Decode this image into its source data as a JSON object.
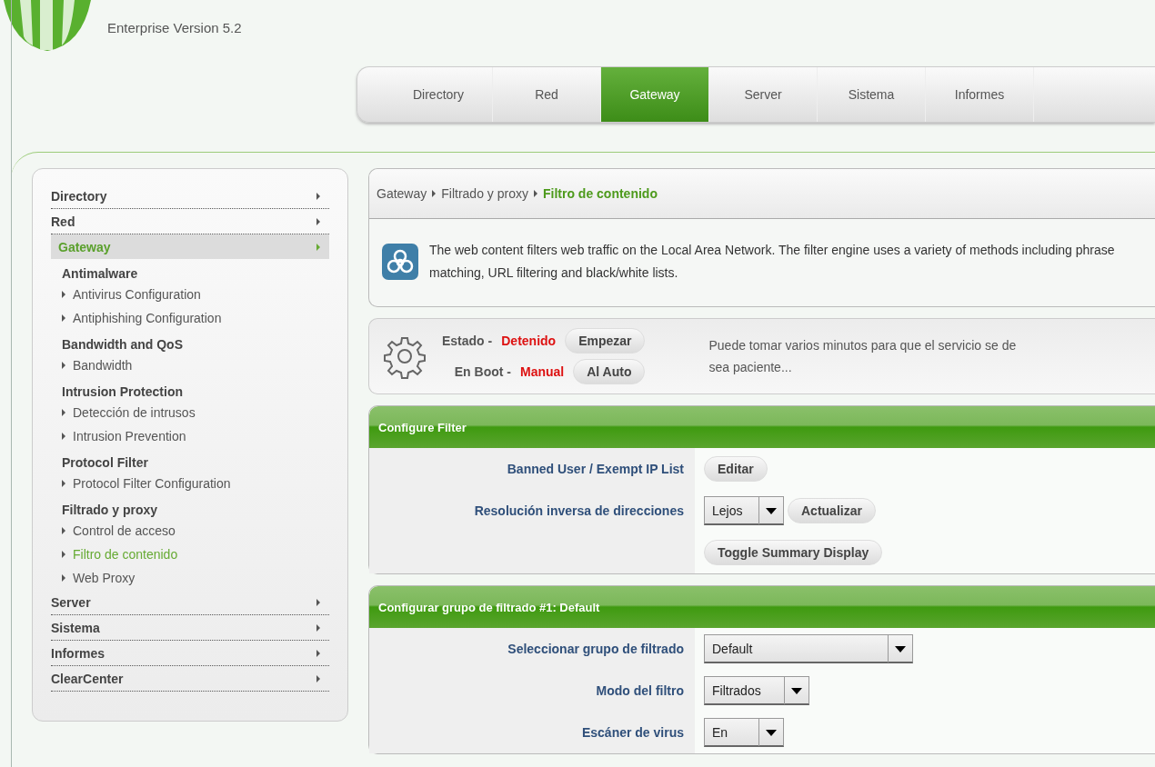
{
  "header": {
    "version": "Enterprise Version 5.2"
  },
  "top_tabs": [
    {
      "label": "Directory",
      "selected": false
    },
    {
      "label": "Red",
      "selected": false
    },
    {
      "label": "Gateway",
      "selected": true
    },
    {
      "label": "Server",
      "selected": false
    },
    {
      "label": "Sistema",
      "selected": false
    },
    {
      "label": "Informes",
      "selected": false
    }
  ],
  "sidebar": {
    "items": [
      {
        "label": "Directory",
        "selected": false
      },
      {
        "label": "Red",
        "selected": false
      },
      {
        "label": "Gateway",
        "selected": true,
        "children": [
          {
            "label": "Antimalware",
            "children": [
              {
                "label": "Antivirus Configuration",
                "selected": false
              },
              {
                "label": "Antiphishing Configuration",
                "selected": false
              }
            ]
          },
          {
            "label": "Bandwidth and QoS",
            "children": [
              {
                "label": "Bandwidth",
                "selected": false
              }
            ]
          },
          {
            "label": "Intrusion Protection",
            "children": [
              {
                "label": "Detección de intrusos",
                "selected": false
              },
              {
                "label": "Intrusion Prevention",
                "selected": false
              }
            ]
          },
          {
            "label": "Protocol Filter",
            "children": [
              {
                "label": "Protocol Filter Configuration",
                "selected": false
              }
            ]
          },
          {
            "label": "Filtrado y proxy",
            "children": [
              {
                "label": "Control de acceso",
                "selected": false
              },
              {
                "label": "Filtro de contenido",
                "selected": true
              },
              {
                "label": "Web Proxy",
                "selected": false
              }
            ]
          }
        ]
      },
      {
        "label": "Server",
        "selected": false
      },
      {
        "label": "Sistema",
        "selected": false
      },
      {
        "label": "Informes",
        "selected": false
      },
      {
        "label": "ClearCenter",
        "selected": false
      }
    ]
  },
  "breadcrumb": [
    {
      "label": "Gateway",
      "current": false
    },
    {
      "label": "Filtrado y proxy",
      "current": false
    },
    {
      "label": "Filtro de contenido",
      "current": true
    }
  ],
  "info": {
    "text": "The web content filters web traffic on the Local Area Network. The filter engine uses a variety of methods including phrase matching, URL filtering and black/white lists."
  },
  "service": {
    "rows": [
      {
        "label": "Estado -",
        "value": "Detenido",
        "button": "Empezar"
      },
      {
        "label": "En Boot -",
        "value": "Manual",
        "button": "Al Auto"
      }
    ],
    "note": [
      "Puede tomar varios minutos para que el servicio se de",
      "sea paciente..."
    ]
  },
  "sections": [
    {
      "title": "Configure Filter",
      "rows": [
        {
          "label": "Banned User / Exempt IP List",
          "controls": [
            {
              "kind": "button",
              "label": "Editar"
            }
          ]
        },
        {
          "label": "Resolución inversa de direcciones",
          "controls": [
            {
              "kind": "select",
              "value": "Lejos"
            },
            {
              "kind": "button",
              "label": "Actualizar"
            }
          ]
        },
        {
          "controls": [
            {
              "kind": "button",
              "label": "Toggle Summary Display"
            }
          ]
        }
      ]
    },
    {
      "title": "Configurar grupo de filtrado #1: Default",
      "rows": [
        {
          "label": "Seleccionar grupo de filtrado",
          "controls": [
            {
              "kind": "select",
              "value": "Default"
            }
          ]
        },
        {
          "label": "Modo del filtro",
          "controls": [
            {
              "kind": "select",
              "value": "Filtrados"
            }
          ]
        },
        {
          "label": "Escáner de virus",
          "controls": [
            {
              "kind": "select",
              "value": "En"
            }
          ]
        }
      ]
    }
  ]
}
